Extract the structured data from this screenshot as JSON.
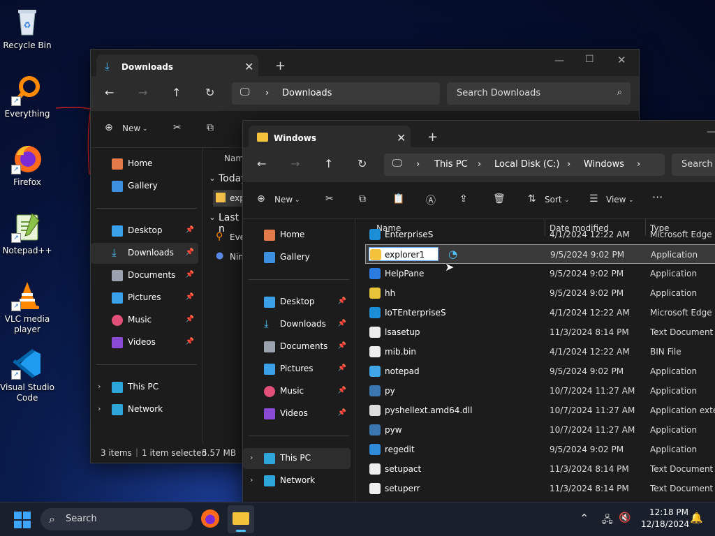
{
  "desktop": {
    "icons": [
      {
        "label": "Recycle Bin"
      },
      {
        "label": "Everything"
      },
      {
        "label": "Firefox"
      },
      {
        "label": "Notepad++"
      },
      {
        "label": "VLC media player"
      },
      {
        "label": "Visual Studio Code"
      }
    ]
  },
  "win1": {
    "tab_title": "Downloads",
    "address": "Downloads",
    "search_placeholder": "Search Downloads",
    "new_label": "New",
    "sidebar": {
      "home": "Home",
      "gallery": "Gallery",
      "desktop": "Desktop",
      "downloads": "Downloads",
      "documents": "Documents",
      "pictures": "Pictures",
      "music": "Music",
      "videos": "Videos",
      "thispc": "This PC",
      "network": "Network"
    },
    "col_name": "Nam",
    "group_today": "Today",
    "group_last": "Last n",
    "file1": "explo",
    "file2": "Ever",
    "file3": "Nin",
    "status": {
      "items": "3 items",
      "selected": "1 item selected",
      "size": "5.57 MB"
    }
  },
  "win2": {
    "tab_title": "Windows",
    "breadcrumb": [
      "This PC",
      "Local Disk (C:)",
      "Windows"
    ],
    "search_placeholder": "Search W",
    "toolbar": {
      "new": "New",
      "sort": "Sort",
      "view": "View"
    },
    "sidebar": {
      "home": "Home",
      "gallery": "Gallery",
      "desktop": "Desktop",
      "downloads": "Downloads",
      "documents": "Documents",
      "pictures": "Pictures",
      "music": "Music",
      "videos": "Videos",
      "thispc": "This PC",
      "network": "Network"
    },
    "columns": {
      "name": "Name",
      "date": "Date modified",
      "type": "Type"
    },
    "rename_value": "explorer1",
    "files": [
      {
        "name": "EnterpriseS",
        "date": "4/1/2024 12:22 AM",
        "type": "Microsoft Edge H..."
      },
      {
        "name": "explorer1",
        "date": "9/5/2024 9:02 PM",
        "type": "Application"
      },
      {
        "name": "HelpPane",
        "date": "9/5/2024 9:02 PM",
        "type": "Application"
      },
      {
        "name": "hh",
        "date": "9/5/2024 9:02 PM",
        "type": "Application"
      },
      {
        "name": "IoTEnterpriseS",
        "date": "4/1/2024 12:22 AM",
        "type": "Microsoft Edge H..."
      },
      {
        "name": "lsasetup",
        "date": "11/3/2024 8:14 PM",
        "type": "Text Document"
      },
      {
        "name": "mib.bin",
        "date": "4/1/2024 12:22 AM",
        "type": "BIN File"
      },
      {
        "name": "notepad",
        "date": "9/5/2024 9:02 PM",
        "type": "Application"
      },
      {
        "name": "py",
        "date": "10/7/2024 11:27 AM",
        "type": "Application"
      },
      {
        "name": "pyshellext.amd64.dll",
        "date": "10/7/2024 11:27 AM",
        "type": "Application extens"
      },
      {
        "name": "pyw",
        "date": "10/7/2024 11:27 AM",
        "type": "Application"
      },
      {
        "name": "regedit",
        "date": "9/5/2024 9:02 PM",
        "type": "Application"
      },
      {
        "name": "setupact",
        "date": "11/3/2024 8:14 PM",
        "type": "Text Document"
      },
      {
        "name": "setuperr",
        "date": "11/3/2024 8:14 PM",
        "type": "Text Document"
      }
    ]
  },
  "taskbar": {
    "search": "Search",
    "time": "12:18 PM",
    "date": "12/18/2024"
  },
  "colors": {
    "accent": "#4cc2ff",
    "selected_row": "#3a3a3a",
    "window_bg": "#1c1c1c"
  }
}
